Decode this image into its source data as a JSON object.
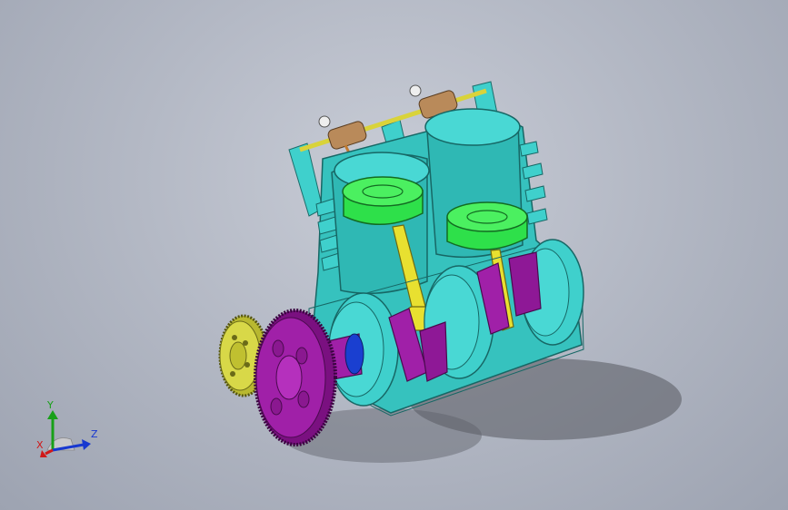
{
  "triad": {
    "x_label": "X",
    "y_label": "Y",
    "z_label": "Z",
    "colors": {
      "x": "#d01818",
      "y": "#18a018",
      "z": "#1838d0"
    }
  },
  "model": {
    "icon": "twin-cylinder-engine-model",
    "colors": {
      "block": "#3fd0cc",
      "piston_crown": "#2ee04a",
      "connecting_rod": "#e8e030",
      "crankshaft": "#a020a8",
      "flywheel": "#9a1a9c",
      "timing_gear": "#c8c840",
      "valve_train": "#b98a5a",
      "background": "#b4b9c5"
    }
  }
}
